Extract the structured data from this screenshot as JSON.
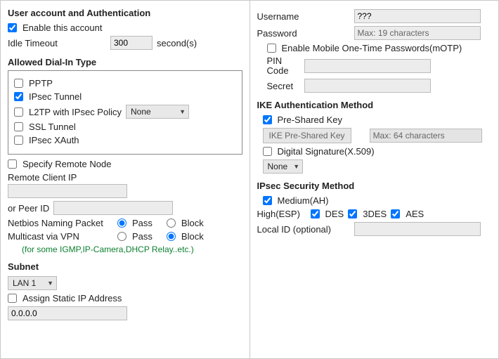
{
  "left": {
    "section1_title": "User account and Authentication",
    "enable_account_label": "Enable this account",
    "enable_account_checked": true,
    "idle_timeout_label": "Idle Timeout",
    "idle_timeout_value": "300",
    "idle_timeout_unit": "second(s)",
    "dialin_title": "Allowed Dial-In Type",
    "dialin": {
      "pptp": {
        "label": "PPTP",
        "checked": false
      },
      "ipsec_tunnel": {
        "label": "IPsec Tunnel",
        "checked": true
      },
      "l2tp": {
        "label": "L2TP with IPsec Policy",
        "checked": false,
        "select": "None"
      },
      "ssl": {
        "label": "SSL Tunnel",
        "checked": false
      },
      "xauth": {
        "label": "IPsec XAuth",
        "checked": false
      }
    },
    "specify_remote_label": "Specify Remote Node",
    "specify_remote_checked": false,
    "remote_client_ip_label": "Remote Client IP",
    "remote_client_ip_value": "",
    "or_peer_id_label": "or Peer ID",
    "or_peer_id_value": "",
    "netbios_label": "Netbios Naming Packet",
    "pass_label": "Pass",
    "block_label": "Block",
    "netbios_selected": "pass",
    "multicast_label": "Multicast via VPN",
    "multicast_selected": "block",
    "note": "(for some IGMP,IP-Camera,DHCP Relay..etc.)",
    "subnet_title": "Subnet",
    "subnet_select": "LAN 1",
    "assign_static_label": "Assign Static IP Address",
    "assign_static_checked": false,
    "static_ip_value": "0.0.0.0"
  },
  "right": {
    "username_label": "Username",
    "username_value": "???",
    "password_label": "Password",
    "password_placeholder": "Max: 19 characters",
    "enable_motp_label": "Enable Mobile One-Time Passwords(mOTP)",
    "enable_motp_checked": false,
    "pin_code_label": "PIN Code",
    "pin_code_value": "",
    "secret_label": "Secret",
    "secret_value": "",
    "ike_title": "IKE Authentication Method",
    "psk_label": "Pre-Shared Key",
    "psk_checked": true,
    "psk_button": "IKE Pre-Shared Key",
    "psk_placeholder": "Max: 64 characters",
    "digital_sig_label": "Digital Signature(X.509)",
    "digital_sig_checked": false,
    "digital_sig_select": "None",
    "ipsec_sec_title": "IPsec Security Method",
    "medium_label": "Medium(AH)",
    "medium_checked": true,
    "high_label": "High(ESP)",
    "des_label": "DES",
    "des_checked": true,
    "tdes_label": "3DES",
    "tdes_checked": true,
    "aes_label": "AES",
    "aes_checked": true,
    "local_id_label": "Local ID (optional)",
    "local_id_value": ""
  }
}
